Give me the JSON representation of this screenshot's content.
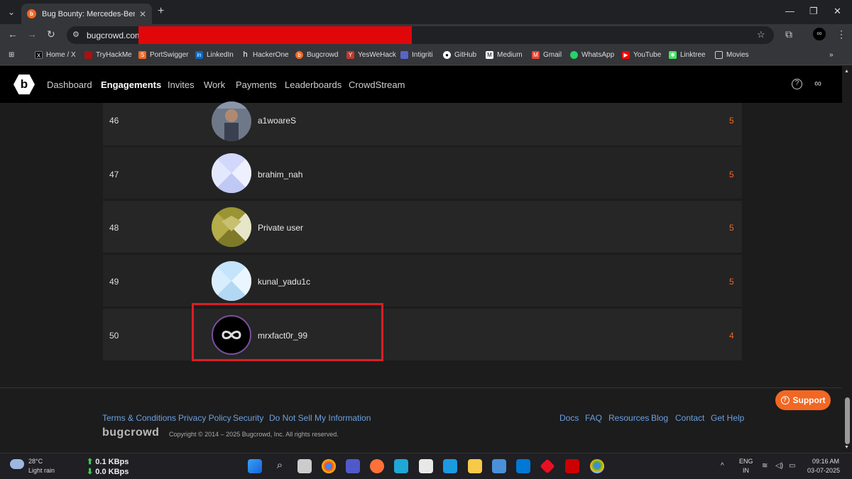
{
  "browser": {
    "tab_title": "Bug Bounty: Mercedes-Benz M",
    "url": "bugcrowd.com/",
    "bookmarks": [
      "Home / X",
      "TryHackMe",
      "PortSwigger",
      "LinkedIn",
      "HackerOne",
      "Bugcrowd",
      "YesWeHack",
      "Intigriti",
      "GitHub",
      "Medium",
      "Gmail",
      "WhatsApp",
      "YouTube",
      "Linktree",
      "Movies"
    ]
  },
  "nav": {
    "items": [
      "Dashboard",
      "Engagements",
      "Invites",
      "Work",
      "Payments",
      "Leaderboards",
      "CrowdStream"
    ],
    "active": "Engagements"
  },
  "leaderboard": {
    "rows": [
      {
        "rank": "46",
        "username": "a1woareS",
        "points": "5"
      },
      {
        "rank": "47",
        "username": "brahim_nah",
        "points": "5"
      },
      {
        "rank": "48",
        "username": "Private user",
        "points": "5"
      },
      {
        "rank": "49",
        "username": "kunal_yadu1c",
        "points": "5"
      },
      {
        "rank": "50",
        "username": "mrxfact0r_99",
        "points": "4"
      }
    ]
  },
  "footer": {
    "left_links": [
      "Terms & Conditions",
      "Privacy Policy",
      "Security",
      "Do Not Sell My Information"
    ],
    "right_links": [
      "Docs",
      "FAQ",
      "Resources",
      "Blog",
      "Contact",
      "Get Help"
    ],
    "wordmark": "bugcrowd",
    "copyright": "Copyright © 2014 – 2025 Bugcrowd, Inc. All rights reserved.",
    "support_label": "Support"
  },
  "taskbar": {
    "temperature": "28°C",
    "weather": "Light rain",
    "upload": "0.1 KBps",
    "download": "0.0 KBps",
    "lang": "ENG",
    "region": "IN",
    "time": "09:16 AM",
    "date": "03-07-2025"
  },
  "colors": {
    "accent": "#f26722",
    "highlight": "#d91f26",
    "link": "#6aa0e0"
  }
}
